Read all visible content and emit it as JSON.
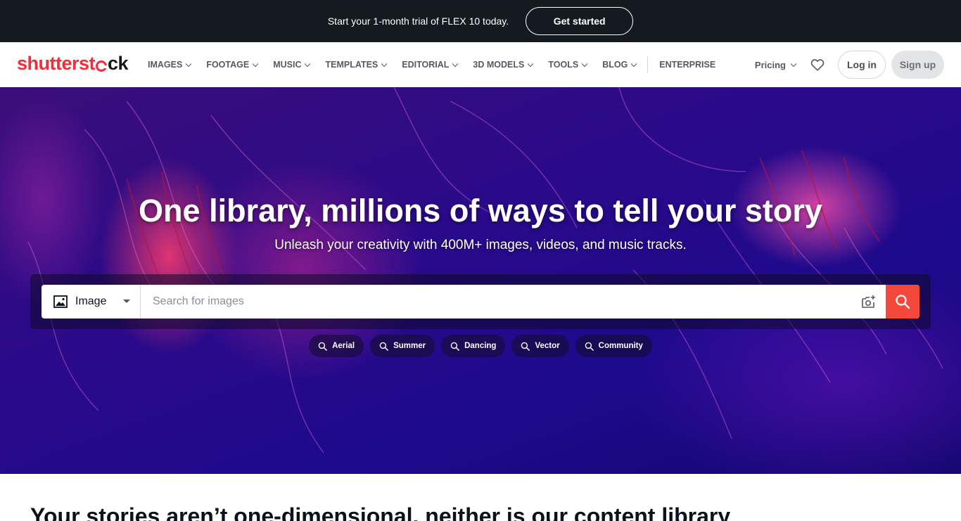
{
  "promo": {
    "text": "Start your 1-month trial of FLEX 10 today.",
    "cta": "Get started"
  },
  "logo": {
    "part1": "shutterst",
    "part2": "ck"
  },
  "nav": {
    "items": [
      {
        "label": "IMAGES",
        "dropdown": true
      },
      {
        "label": "FOOTAGE",
        "dropdown": true
      },
      {
        "label": "MUSIC",
        "dropdown": true
      },
      {
        "label": "TEMPLATES",
        "dropdown": true
      },
      {
        "label": "EDITORIAL",
        "dropdown": true
      },
      {
        "label": "3D MODELS",
        "dropdown": true
      },
      {
        "label": "TOOLS",
        "dropdown": true
      },
      {
        "label": "BLOG",
        "dropdown": true
      }
    ],
    "enterprise": "ENTERPRISE",
    "pricing": "Pricing",
    "login": "Log in",
    "signup": "Sign up"
  },
  "hero": {
    "title": "One library, millions of ways to tell your story",
    "subtitle": "Unleash your creativity with 400M+ images, videos, and music tracks."
  },
  "search": {
    "type": "Image",
    "placeholder": "Search for images"
  },
  "chips": [
    "Aerial",
    "Summer",
    "Dancing",
    "Vector",
    "Community"
  ],
  "section": {
    "title": "Your stories aren’t one-dimensional, neither is our content library"
  },
  "colors": {
    "brand_red": "#f52c39",
    "search_button": "#f5483d",
    "promo_bg": "#151a21"
  },
  "icons": {
    "search": "search-icon",
    "camera": "camera-search-icon",
    "heart": "heart-icon",
    "image": "image-icon"
  }
}
